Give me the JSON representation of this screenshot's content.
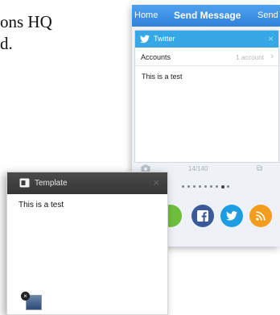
{
  "background_text": {
    "line1": "ons HQ",
    "line2": "d."
  },
  "send_screen": {
    "nav_left": "Home",
    "title": "Send Message",
    "nav_right": "Send",
    "service_label": "Twitter",
    "close_glyph": "×",
    "accounts_label": "Accounts",
    "accounts_value": "1 account",
    "chevron_glyph": "›",
    "message": "This is a test",
    "char_count": "14/140",
    "page_dots": {
      "count": 9,
      "active_index": 7
    },
    "share_buttons": [
      {
        "name": "green-button",
        "color": "#6fbf3c"
      },
      {
        "name": "facebook-button",
        "color": "#3c5a99",
        "glyph": "f"
      },
      {
        "name": "twitter-button",
        "color": "#1e9de2"
      },
      {
        "name": "rss-button",
        "color": "#f39c1e"
      }
    ]
  },
  "template_screen": {
    "title": "Template",
    "close_glyph": "×",
    "message": "This is a test",
    "delete_glyph": "×"
  },
  "icons": [
    "twitter-icon",
    "camera-icon",
    "copy-icon",
    "template-icon",
    "facebook-icon",
    "rss-icon"
  ]
}
